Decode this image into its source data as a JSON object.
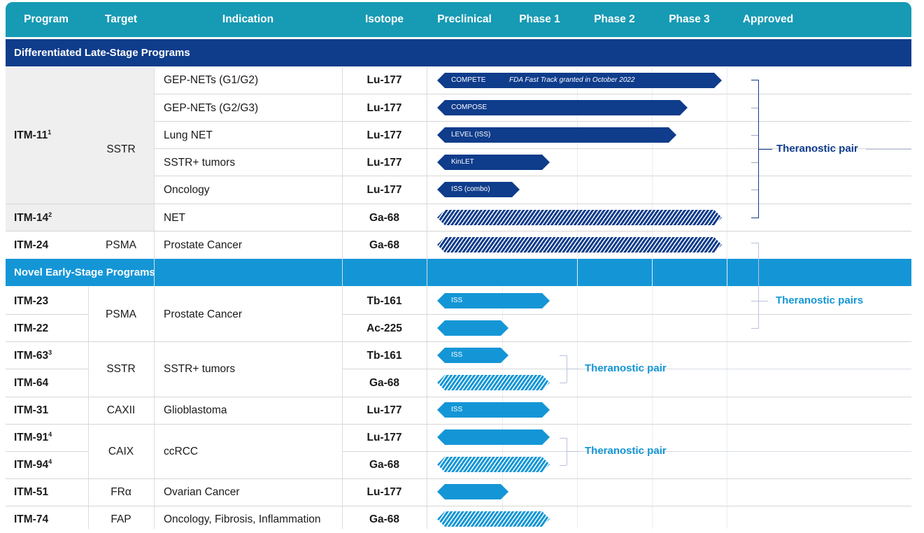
{
  "header": {
    "program": "Program",
    "target": "Target",
    "indication": "Indication",
    "isotope": "Isotope",
    "preclinical": "Preclinical",
    "phase1": "Phase 1",
    "phase2": "Phase 2",
    "phase3": "Phase 3",
    "approved": "Approved"
  },
  "sections": {
    "late": "Differentiated Late-Stage Programs",
    "early": "Novel Early-Stage Programs"
  },
  "colors": {
    "header_bg": "#179ab4",
    "late_band": "#0f3c8b",
    "early_band": "#1496d6",
    "late_bar": "#0f3c8b",
    "early_bar": "#1496d6"
  },
  "programs": [
    {
      "name": "ITM-11",
      "sup": "1"
    },
    {
      "name": "ITM-14",
      "sup": "2"
    },
    {
      "name": "ITM-24",
      "sup": ""
    },
    {
      "name": "ITM-23",
      "sup": ""
    },
    {
      "name": "ITM-22",
      "sup": ""
    },
    {
      "name": "ITM-63",
      "sup": "3"
    },
    {
      "name": "ITM-64",
      "sup": ""
    },
    {
      "name": "ITM-31",
      "sup": ""
    },
    {
      "name": "ITM-91",
      "sup": "4"
    },
    {
      "name": "ITM-94",
      "sup": "4"
    },
    {
      "name": "ITM-51",
      "sup": ""
    },
    {
      "name": "ITM-74",
      "sup": ""
    }
  ],
  "targets": [
    "SSTR",
    "PSMA",
    "PSMA",
    "SSTR",
    "CAXII",
    "CAIX",
    "FRα",
    "FAP"
  ],
  "indications": [
    "GEP-NETs (G1/G2)",
    "GEP-NETs (G2/G3)",
    "Lung NET",
    "SSTR+ tumors",
    "Oncology",
    "NET",
    "Prostate Cancer",
    "Prostate Cancer",
    "SSTR+ tumors",
    "Glioblastoma",
    "ccRCC",
    "Ovarian Cancer",
    "Oncology, Fibrosis, Inflammation"
  ],
  "isotopes": [
    "Lu-177",
    "Lu-177",
    "Lu-177",
    "Lu-177",
    "Lu-177",
    "Ga-68",
    "Ga-68",
    "Tb-161",
    "Ac-225",
    "Tb-161",
    "Ga-68",
    "Lu-177",
    "Lu-177",
    "Ga-68",
    "Lu-177",
    "Ga-68"
  ],
  "bars": [
    {
      "label": "COMPETE",
      "note": "FDA Fast Track granted in October 2022",
      "stage_progress": 3.8,
      "style": "solid",
      "group": "late"
    },
    {
      "label": "COMPOSE",
      "note": "",
      "stage_progress": 3.35,
      "style": "solid",
      "group": "late"
    },
    {
      "label": "LEVEL (ISS)",
      "note": "",
      "stage_progress": 3.2,
      "style": "solid",
      "group": "late"
    },
    {
      "label": "KinLET",
      "note": "",
      "stage_progress": 1.5,
      "style": "solid",
      "group": "late"
    },
    {
      "label": "ISS (combo)",
      "note": "",
      "stage_progress": 1.1,
      "style": "solid",
      "group": "late"
    },
    {
      "label": "",
      "note": "",
      "stage_progress": 3.8,
      "style": "hatched",
      "group": "late"
    },
    {
      "label": "",
      "note": "",
      "stage_progress": 3.8,
      "style": "hatched",
      "group": "late"
    },
    {
      "label": "ISS",
      "note": "",
      "stage_progress": 1.5,
      "style": "solid",
      "group": "early"
    },
    {
      "label": "",
      "note": "",
      "stage_progress": 0.95,
      "style": "solid",
      "group": "early"
    },
    {
      "label": "ISS",
      "note": "",
      "stage_progress": 0.95,
      "style": "solid",
      "group": "early"
    },
    {
      "label": "",
      "note": "",
      "stage_progress": 1.5,
      "style": "hatched",
      "group": "early"
    },
    {
      "label": "ISS",
      "note": "",
      "stage_progress": 1.5,
      "style": "solid",
      "group": "early"
    },
    {
      "label": "",
      "note": "",
      "stage_progress": 1.5,
      "style": "solid",
      "group": "early"
    },
    {
      "label": "",
      "note": "",
      "stage_progress": 1.5,
      "style": "hatched",
      "group": "early"
    },
    {
      "label": "",
      "note": "",
      "stage_progress": 0.95,
      "style": "solid",
      "group": "early"
    },
    {
      "label": "",
      "note": "",
      "stage_progress": 1.5,
      "style": "hatched",
      "group": "early"
    }
  ],
  "pairs": {
    "p1": "Theranostic pair",
    "p2": "Theranostic pairs",
    "p3": "Theranostic pair",
    "p4": "Theranostic pair"
  }
}
